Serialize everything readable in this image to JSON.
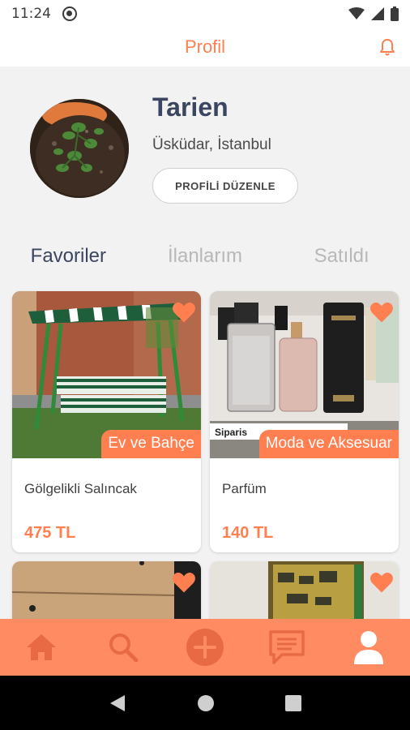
{
  "status_bar": {
    "time": "11:24",
    "icons": [
      "sync-icon",
      "wifi-icon",
      "signal-icon",
      "battery-icon"
    ]
  },
  "header": {
    "title": "Profil",
    "icon": "bell-icon"
  },
  "profile": {
    "name": "Tarien",
    "location": "Üsküdar, İstanbul",
    "edit_label": "PROFİLİ DÜZENLE"
  },
  "tabs": [
    {
      "label": "Favoriler",
      "active": true
    },
    {
      "label": "İlanlarım",
      "active": false
    },
    {
      "label": "Satıldı",
      "active": false
    }
  ],
  "listings": [
    {
      "title": "Gölgelikli Salıncak",
      "price": "475 TL",
      "category": "Ev ve Bahçe",
      "favorited": true
    },
    {
      "title": "Parfüm",
      "price": "140 TL",
      "category": "Moda ve Aksesuar",
      "favorited": true,
      "image_caption": "Siparis"
    },
    {
      "title": "",
      "price": "",
      "category": "",
      "favorited": true
    },
    {
      "title": "",
      "price": "",
      "category": "",
      "favorited": true
    }
  ],
  "bottom_nav": [
    "home-icon",
    "search-icon",
    "add-icon",
    "messages-icon",
    "profile-icon"
  ],
  "system_nav": [
    "back-icon",
    "home-circle-icon",
    "recents-icon"
  ],
  "colors": {
    "accent": "#ff7f50",
    "nav_bg": "#ff8b63",
    "text_dark": "#3b4560"
  }
}
